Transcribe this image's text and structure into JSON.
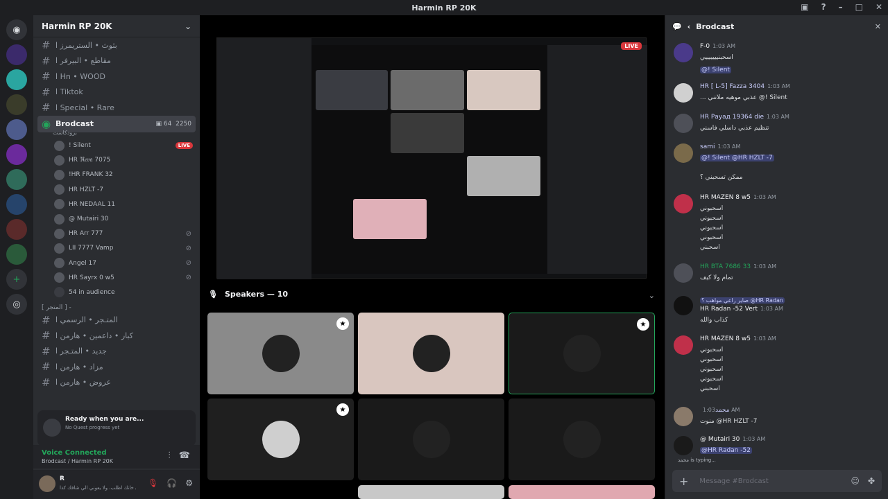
{
  "window": {
    "title": "Harmin RP 20K"
  },
  "server": {
    "name": "Harmin RP 20K"
  },
  "channels": [
    {
      "name": "بثوث • الستريمرز ا"
    },
    {
      "name": "مقاطع • البيرفر ا"
    },
    {
      "name": "Hn • WOOD ا"
    },
    {
      "name": "Tiktok ا"
    },
    {
      "name": "Special • Rare ا"
    }
  ],
  "active_channel": {
    "name": "Brodcast",
    "sub": "برودكاست",
    "cams": "64",
    "listeners": "2250"
  },
  "voice_users": [
    {
      "name": "! Silent",
      "badge": "LIVE"
    },
    {
      "name": "HR ℜ𝔢𝔳𝔞 7075"
    },
    {
      "name": "!HR FRANK 32"
    },
    {
      "name": "HR HZLT -7"
    },
    {
      "name": "HR NEDAAL 11"
    },
    {
      "name": "@ Mutairi 30"
    },
    {
      "name": "HR Arr 777"
    },
    {
      "name": "LII 7777 Vamp"
    },
    {
      "name": "Angel 17"
    },
    {
      "name": "HR Sayrx 0 w5"
    },
    {
      "name": "54 in audience"
    }
  ],
  "category2": "[ المتجر ] -",
  "channels2": [
    {
      "name": "المتـجر • الرسمي ا"
    },
    {
      "name": "كبار • داعمين • هارمن ا"
    },
    {
      "name": "جديد • المتـجر ا"
    },
    {
      "name": "مزاد • هارمن ا"
    },
    {
      "name": "عروض • هارمن ا"
    }
  ],
  "quest": {
    "title": "Ready when you are...",
    "sub": "No Quest progress yet"
  },
  "voice": {
    "status": "Voice Connected",
    "where": "Brodcast / Harmin RP 20K"
  },
  "user": {
    "name": "R",
    "status": "الي خانك اطلب، ولا يعوني الي شافك كذا"
  },
  "stream": {
    "live": "LIVE"
  },
  "speakers": {
    "label": "Speakers — 10"
  },
  "chat": {
    "title": "Brodcast",
    "messages": [
      {
        "author": "F-0",
        "time": "1:03 AM",
        "lines": [
          "اسحبنيييييييي",
          "@! Silent"
        ]
      },
      {
        "author": "HR [ L-5] Fazza 3404",
        "time": "1:03 AM",
        "lines": [
          "... عذبي موهيه ملانني @! Silent"
        ]
      },
      {
        "author": "HR Рауад 19364 die",
        "time": "1:03 AM",
        "lines": [
          "تنظيم عذبي داسلي فاسني"
        ]
      },
      {
        "author": "sami",
        "time": "1:03 AM",
        "lines": [
          "@! Silent @HR HZLT -7",
          "ممكن تسحبني ؟"
        ]
      },
      {
        "author": "HR MAZEN 8 w5",
        "time": "1:03 AM",
        "lines": [
          "اسحبوني",
          "اسحبوني",
          "اسحبوني",
          "اسحبوني",
          "اسحبني"
        ]
      },
      {
        "author": "HR BTA 7686 33",
        "time": "1:03 AM",
        "lines": [
          "تمام ولا كيف"
        ]
      },
      {
        "author": "HR Radan -52 Vert",
        "time": "1:03 AM",
        "lines": [
          "صاير راعي مواهب ؟ @HR Radan",
          "كذاب والله"
        ]
      },
      {
        "author": "HR MAZEN 8 w5",
        "time": "1:03 AM",
        "lines": [
          "اسحبوني",
          "اسحبوني",
          "اسحبوني",
          "اسحبوني",
          "اسحبني"
        ]
      },
      {
        "author": "محمد",
        "time": "1:03 AM",
        "lines": [
          "منوت @HR HZLT -7"
        ]
      },
      {
        "author": "@ Mutairi 30",
        "time": "1:03 AM",
        "lines": [
          "@HR Radan -52"
        ]
      }
    ],
    "typing": "محمد is typing...",
    "placeholder": "Message #Brodcast"
  }
}
